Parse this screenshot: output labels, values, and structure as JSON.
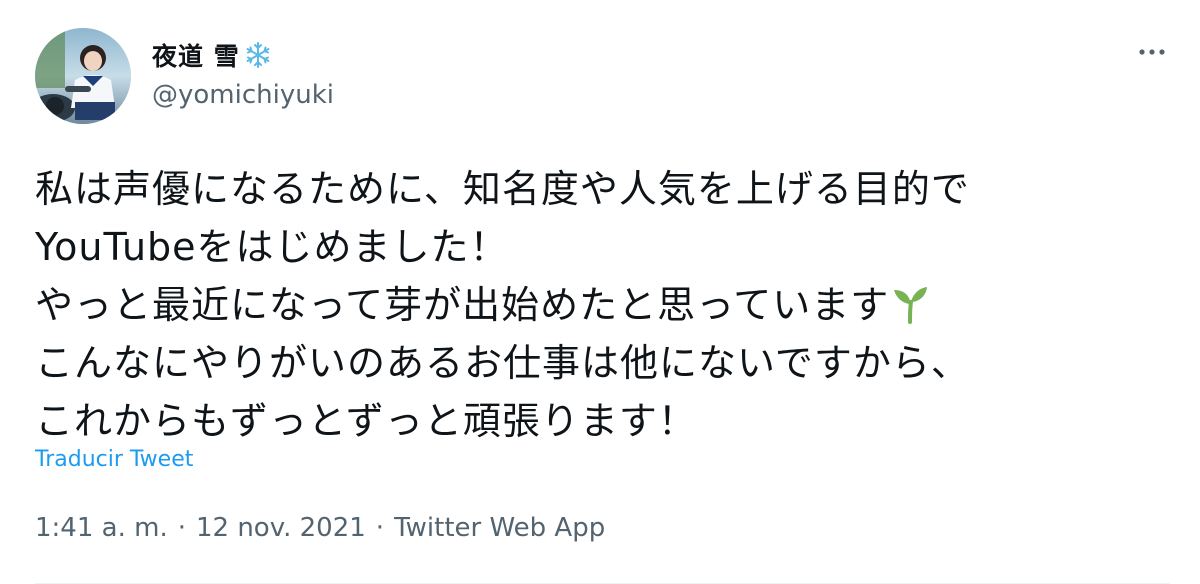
{
  "author": {
    "display_name": "夜道 雪",
    "handle": "@yomichiyuki",
    "name_emoji_icon": "snowflake-icon"
  },
  "tweet": {
    "lines": [
      "私は声優になるために、知名度や人気を上げる目的で",
      "YouTubeをはじめました！",
      "やっと最近になって芽が出始めたと思っています",
      "こんなにやりがいのあるお仕事は他にないですから、",
      "これからもずっとずっと頑張ります！"
    ],
    "emoji_after_line_3": "sprout-icon"
  },
  "actions": {
    "translate_label": "Traducir Tweet",
    "more_icon": "more-options-icon"
  },
  "meta": {
    "time": "1:41 a. m.",
    "separator": "·",
    "date": "12 nov. 2021",
    "source": "Twitter Web App"
  },
  "colors": {
    "link_blue": "#1d9bf0",
    "secondary_text": "#536471",
    "primary_text": "#0f1419",
    "sprout_green": "#77b255"
  }
}
